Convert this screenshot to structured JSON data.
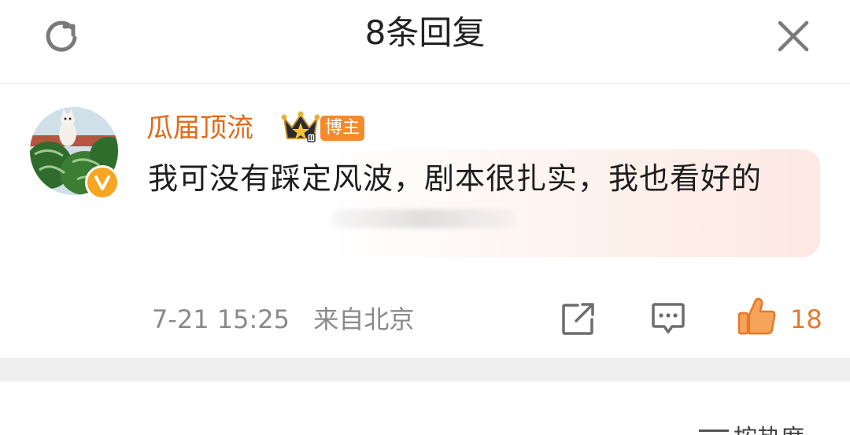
{
  "header": {
    "title": "8条回复",
    "refresh_icon": "refresh-icon",
    "close_icon": "close-icon"
  },
  "comment": {
    "username": "瓜届顶流",
    "badge": "博主",
    "text": "我可没有踩定风波，剧本很扎实，我也看好的",
    "time": "7-21 15:25",
    "location": "来自北京",
    "likes": "18",
    "colors": {
      "username": "#e06a1a",
      "like": "#e8782a",
      "badge": "#f58a2c"
    }
  },
  "footer": {
    "sort_label": "按热度"
  }
}
